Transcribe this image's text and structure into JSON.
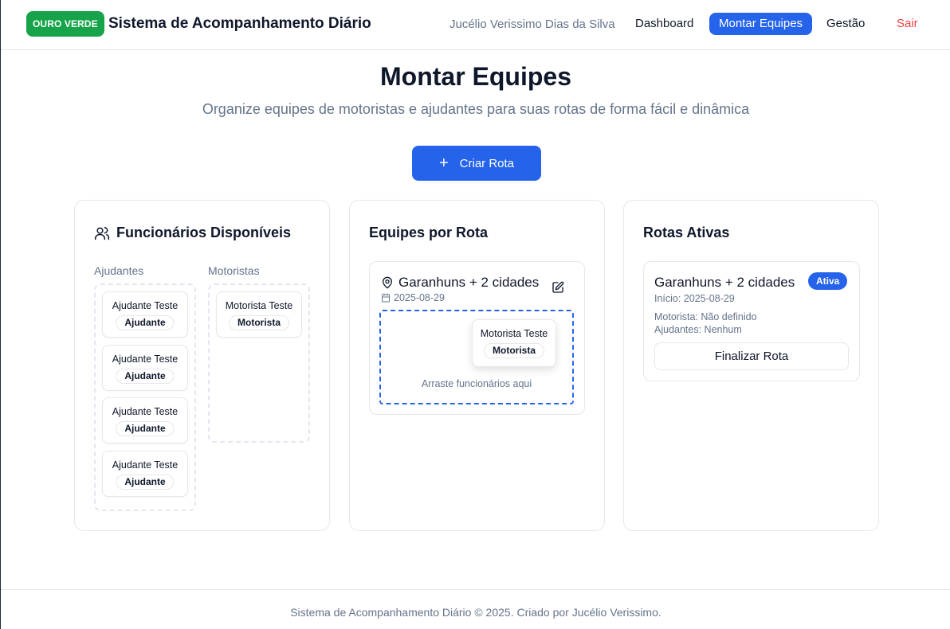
{
  "header": {
    "logo": "OURO VERDE",
    "title": "Sistema de Acompanhamento Diário",
    "user": "Jucélio Verissimo Dias da Silva",
    "nav": {
      "dashboard": "Dashboard",
      "montar": "Montar Equipes",
      "gestao": "Gestão",
      "sair": "Sair"
    }
  },
  "hero": {
    "title": "Montar Equipes",
    "subtitle": "Organize equipes de motoristas e ajudantes para suas rotas de forma fácil e dinâmica",
    "create_button": "Criar Rota"
  },
  "available": {
    "title": "Funcionários Disponíveis",
    "helpers_label": "Ajudantes",
    "drivers_label": "Motoristas",
    "helpers": [
      {
        "name": "Ajudante Teste",
        "role": "Ajudante"
      },
      {
        "name": "Ajudante Teste",
        "role": "Ajudante"
      },
      {
        "name": "Ajudante Teste",
        "role": "Ajudante"
      },
      {
        "name": "Ajudante Teste",
        "role": "Ajudante"
      }
    ],
    "drivers": [
      {
        "name": "Motorista Teste",
        "role": "Motorista"
      }
    ]
  },
  "teams": {
    "title": "Equipes por Rota",
    "route": {
      "name": "Garanhuns + 2 cidades",
      "date": "2025-08-29",
      "dragging": {
        "name": "Motorista Teste",
        "role": "Motorista"
      },
      "drop_hint": "Arraste funcionários aqui"
    }
  },
  "active": {
    "title": "Rotas Ativas",
    "route": {
      "name": "Garanhuns + 2 cidades",
      "badge": "Ativa",
      "start": "Início: 2025-08-29",
      "driver": "Motorista: Não definido",
      "helpers": "Ajudantes: Nenhum",
      "finalize": "Finalizar Rota"
    }
  },
  "footer": {
    "text": "Sistema de Acompanhamento Diário © 2025. Criado por Jucélio Verissimo."
  },
  "colors": {
    "primary": "#2563eb",
    "brand": "#16a34a",
    "danger": "#ef4444",
    "muted": "#64748b"
  }
}
